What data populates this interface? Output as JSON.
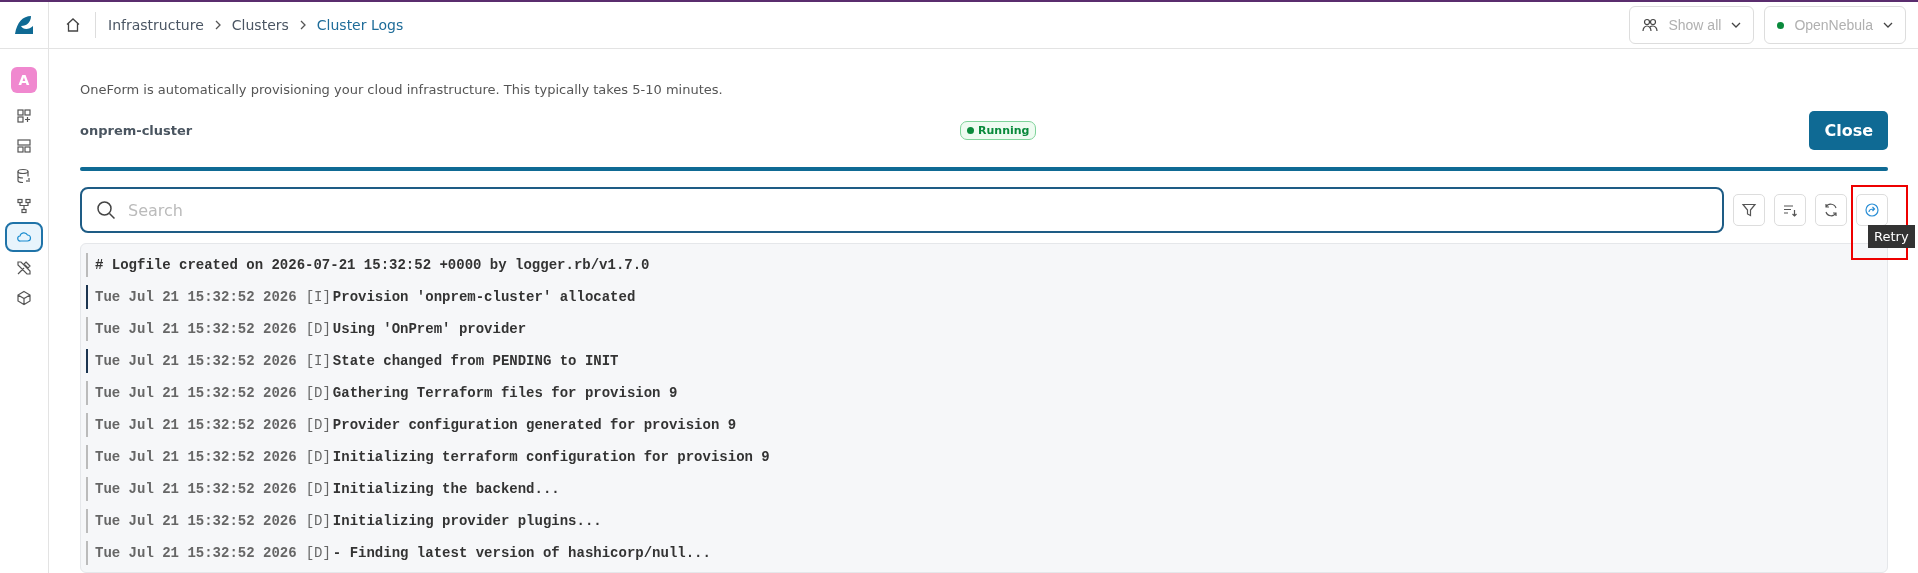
{
  "sidebar": {
    "avatar": "A",
    "items": [
      {
        "kind": "grid-plus",
        "selected": false
      },
      {
        "kind": "dashboard",
        "selected": false
      },
      {
        "kind": "database",
        "selected": false
      },
      {
        "kind": "network",
        "selected": false
      },
      {
        "kind": "cloud",
        "selected": true
      },
      {
        "kind": "tools",
        "selected": false
      },
      {
        "kind": "cube",
        "selected": false
      }
    ]
  },
  "breadcrumb": [
    {
      "label": "Infrastructure",
      "current": false
    },
    {
      "label": "Clusters",
      "current": false
    },
    {
      "label": "Cluster Logs",
      "current": true
    }
  ],
  "topbar": {
    "group_filter": "Show all",
    "zone": "OpenNebula"
  },
  "notice": "OneForm is automatically provisioning your cloud infrastructure. This typically takes 5-10 minutes.",
  "cluster": {
    "name": "onprem-cluster",
    "status": "Running",
    "close_button": "Close",
    "level": 1
  },
  "search": {
    "placeholder": "Search"
  },
  "toolbar": [
    {
      "kind": "filter",
      "active": false
    },
    {
      "kind": "sort",
      "active": false
    },
    {
      "kind": "refresh",
      "active": false
    },
    {
      "kind": "retry",
      "active": true,
      "tooltip": "Retry"
    }
  ],
  "log": [
    {
      "kind": "header",
      "text": "# Logfile created on 2026-07-21 15:32:52 +0000 by logger.rb/v1.7.0"
    },
    {
      "kind": "entry",
      "time": "Tue Jul 21 15:32:52 2026",
      "level": "[I]",
      "message": "Provision 'onprem-cluster' allocated"
    },
    {
      "kind": "entry",
      "time": "Tue Jul 21 15:32:52 2026",
      "level": "[D]",
      "message": "Using 'OnPrem' provider"
    },
    {
      "kind": "entry",
      "time": "Tue Jul 21 15:32:52 2026",
      "level": "[I]",
      "message": "State changed from PENDING to INIT"
    },
    {
      "kind": "entry",
      "time": "Tue Jul 21 15:32:52 2026",
      "level": "[D]",
      "message": "Gathering Terraform files for provision 9"
    },
    {
      "kind": "entry",
      "time": "Tue Jul 21 15:32:52 2026",
      "level": "[D]",
      "message": "Provider configuration generated for provision 9"
    },
    {
      "kind": "entry",
      "time": "Tue Jul 21 15:32:52 2026",
      "level": "[D]",
      "message": "Initializing terraform configuration for provision 9"
    },
    {
      "kind": "entry",
      "time": "Tue Jul 21 15:32:52 2026",
      "level": "[D]",
      "message": "Initializing the backend..."
    },
    {
      "kind": "entry",
      "time": "Tue Jul 21 15:32:52 2026",
      "level": "[D]",
      "message": "Initializing provider plugins..."
    },
    {
      "kind": "entry",
      "time": "Tue Jul 21 15:32:52 2026",
      "level": "[D]",
      "message": "- Finding latest version of hashicorp/null..."
    }
  ]
}
